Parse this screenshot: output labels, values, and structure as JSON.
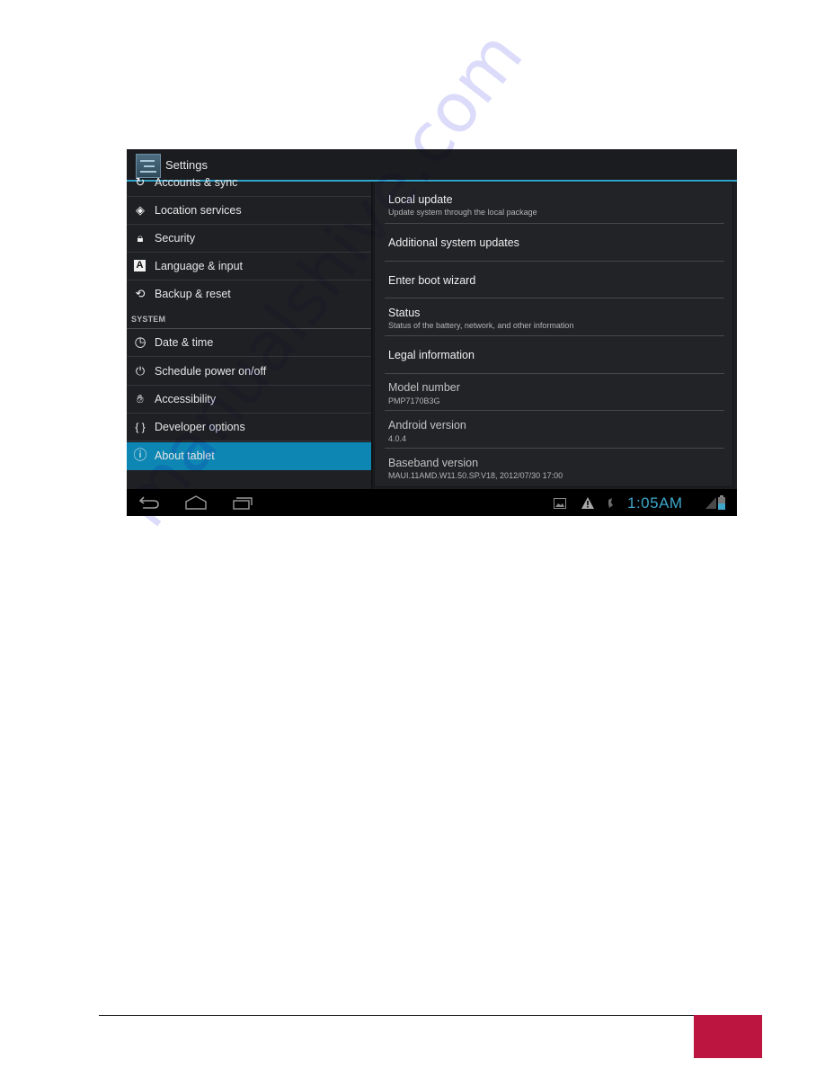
{
  "action_bar": {
    "app_icon": "settings-sliders-icon",
    "title": "Settings"
  },
  "left_pane": {
    "items_top": [
      {
        "label": "Accounts & sync",
        "icon": "sync-icon",
        "glyph": "↻"
      },
      {
        "label": "Location services",
        "icon": "location-icon",
        "glyph": "◈"
      },
      {
        "label": "Security",
        "icon": "lock-icon",
        "glyph": "🔒︎"
      },
      {
        "label": "Language & input",
        "icon": "language-icon",
        "glyph": "A"
      },
      {
        "label": "Backup & reset",
        "icon": "backup-icon",
        "glyph": "⟲"
      }
    ],
    "section_header": "SYSTEM",
    "items_system": [
      {
        "label": "Date & time",
        "icon": "clock-icon",
        "glyph": "◷"
      },
      {
        "label": "Schedule power on/off",
        "icon": "schedule-power-icon",
        "glyph": "⏻"
      },
      {
        "label": "Accessibility",
        "icon": "hand-icon",
        "glyph": "✋︎"
      },
      {
        "label": "Developer options",
        "icon": "braces-icon",
        "glyph": "{ }"
      },
      {
        "label": "About tablet",
        "icon": "info-icon",
        "glyph": "ⓘ",
        "selected": true
      }
    ]
  },
  "right_pane": {
    "items": [
      {
        "title": "Local update",
        "summary": "Update system through the local package"
      },
      {
        "title": "Additional system updates",
        "summary": ""
      },
      {
        "title": "Enter boot wizard",
        "summary": ""
      },
      {
        "title": "Status",
        "summary": "Status of the battery, network, and other information"
      },
      {
        "title": "Legal information",
        "summary": ""
      },
      {
        "title": "Model number",
        "summary": "PMP7170B3G"
      },
      {
        "title": "Android version",
        "summary": "4.0.4"
      },
      {
        "title": "Baseband version",
        "summary": "MAUI.11AMD.W11.50.SP.V18, 2012/07/30 17:00"
      }
    ]
  },
  "nav_bar": {
    "buttons": [
      "back",
      "home",
      "recent-apps"
    ],
    "status_icons": [
      "screenshot-icon",
      "warning-icon",
      "usb-debug-icon",
      "signal-icon",
      "battery-icon"
    ],
    "time": "1:05AM"
  },
  "colors": {
    "accent": "#33a2c8",
    "selected": "#0d86b4",
    "clock": "#3ea6c9",
    "page_marker": "#bb1540"
  },
  "watermark": "manualshive.com"
}
